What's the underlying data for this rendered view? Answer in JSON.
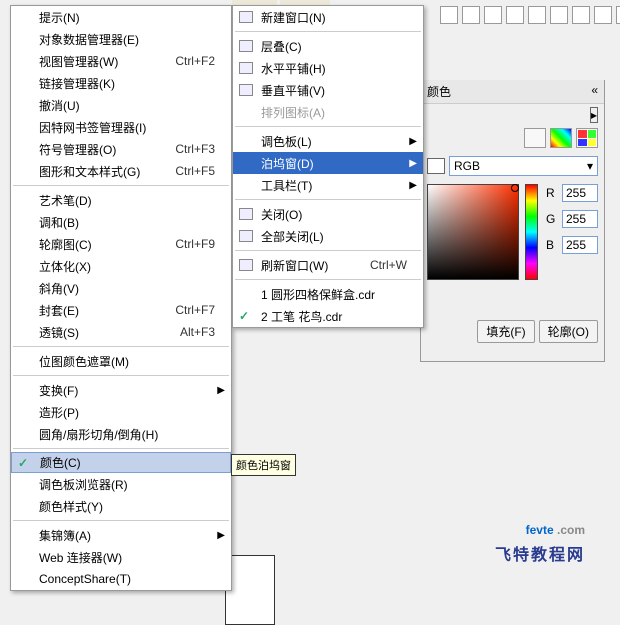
{
  "menu1": {
    "items": [
      {
        "label": "提示(N)",
        "sc": "",
        "arr": false
      },
      {
        "label": "对象数据管理器(E)",
        "sc": "",
        "arr": false
      },
      {
        "label": "视图管理器(W)",
        "sc": "Ctrl+F2",
        "arr": false
      },
      {
        "label": "链接管理器(K)",
        "sc": "",
        "arr": false
      },
      {
        "label": "撤消(U)",
        "sc": "",
        "arr": false
      },
      {
        "label": "因特网书签管理器(I)",
        "sc": "",
        "arr": false
      },
      {
        "label": "符号管理器(O)",
        "sc": "Ctrl+F3",
        "arr": false
      },
      {
        "label": "图形和文本样式(G)",
        "sc": "Ctrl+F5",
        "arr": false
      },
      {
        "sep": true
      },
      {
        "label": "艺术笔(D)",
        "sc": "",
        "arr": false
      },
      {
        "label": "调和(B)",
        "sc": "",
        "arr": false
      },
      {
        "label": "轮廓图(C)",
        "sc": "Ctrl+F9",
        "arr": false
      },
      {
        "label": "立体化(X)",
        "sc": "",
        "arr": false
      },
      {
        "label": "斜角(V)",
        "sc": "",
        "arr": false
      },
      {
        "label": "封套(E)",
        "sc": "Ctrl+F7",
        "arr": false
      },
      {
        "label": "透镜(S)",
        "sc": "Alt+F3",
        "arr": false
      },
      {
        "sep": true
      },
      {
        "label": "位图颜色遮罩(M)",
        "sc": "",
        "arr": false
      },
      {
        "sep": true
      },
      {
        "label": "变换(F)",
        "sc": "",
        "arr": true
      },
      {
        "label": "造形(P)",
        "sc": "",
        "arr": false
      },
      {
        "label": "圆角/扇形切角/倒角(H)",
        "sc": "",
        "arr": false
      },
      {
        "sep": true
      },
      {
        "label": "颜色(C)",
        "sc": "",
        "arr": false,
        "sel": true,
        "chk": true
      },
      {
        "label": "调色板浏览器(R)",
        "sc": "",
        "arr": false
      },
      {
        "label": "颜色样式(Y)",
        "sc": "",
        "arr": false
      },
      {
        "sep": true
      },
      {
        "label": "集锦簿(A)",
        "sc": "",
        "arr": true
      },
      {
        "label": "Web 连接器(W)",
        "sc": "",
        "arr": false
      },
      {
        "label": "ConceptShare(T)",
        "sc": "",
        "arr": false
      }
    ]
  },
  "menu2": {
    "items": [
      {
        "label": "新建窗口(N)",
        "ico": "new"
      },
      {
        "sep": true
      },
      {
        "label": "层叠(C)",
        "ico": "cascade"
      },
      {
        "label": "水平平铺(H)",
        "ico": "tileh"
      },
      {
        "label": "垂直平铺(V)",
        "ico": "tilev"
      },
      {
        "label": "排列图标(A)",
        "ico": "",
        "disabled": true
      },
      {
        "sep": true
      },
      {
        "label": "调色板(L)",
        "arr": true
      },
      {
        "label": "泊坞窗(D)",
        "arr": true,
        "hl": true
      },
      {
        "label": "工具栏(T)",
        "arr": true
      },
      {
        "sep": true
      },
      {
        "label": "关闭(O)",
        "ico": "close"
      },
      {
        "label": "全部关闭(L)",
        "ico": "closeall"
      },
      {
        "sep": true
      },
      {
        "label": "刷新窗口(W)",
        "sc": "Ctrl+W",
        "ico": "refresh"
      },
      {
        "sep": true
      },
      {
        "label": "1 圆形四格保鲜盒.cdr"
      },
      {
        "label": "2 工笔 花鸟.cdr",
        "chk": true
      }
    ]
  },
  "tooltip": "颜色泊坞窗",
  "docker": {
    "title": "颜色",
    "model": "RGB",
    "r": "255",
    "g": "255",
    "b": "255",
    "fill": "填充(F)",
    "outline": "轮廓(O)"
  },
  "watermark": {
    "site": "fevte",
    "dot": " .com",
    "sub": "飞特教程网"
  }
}
